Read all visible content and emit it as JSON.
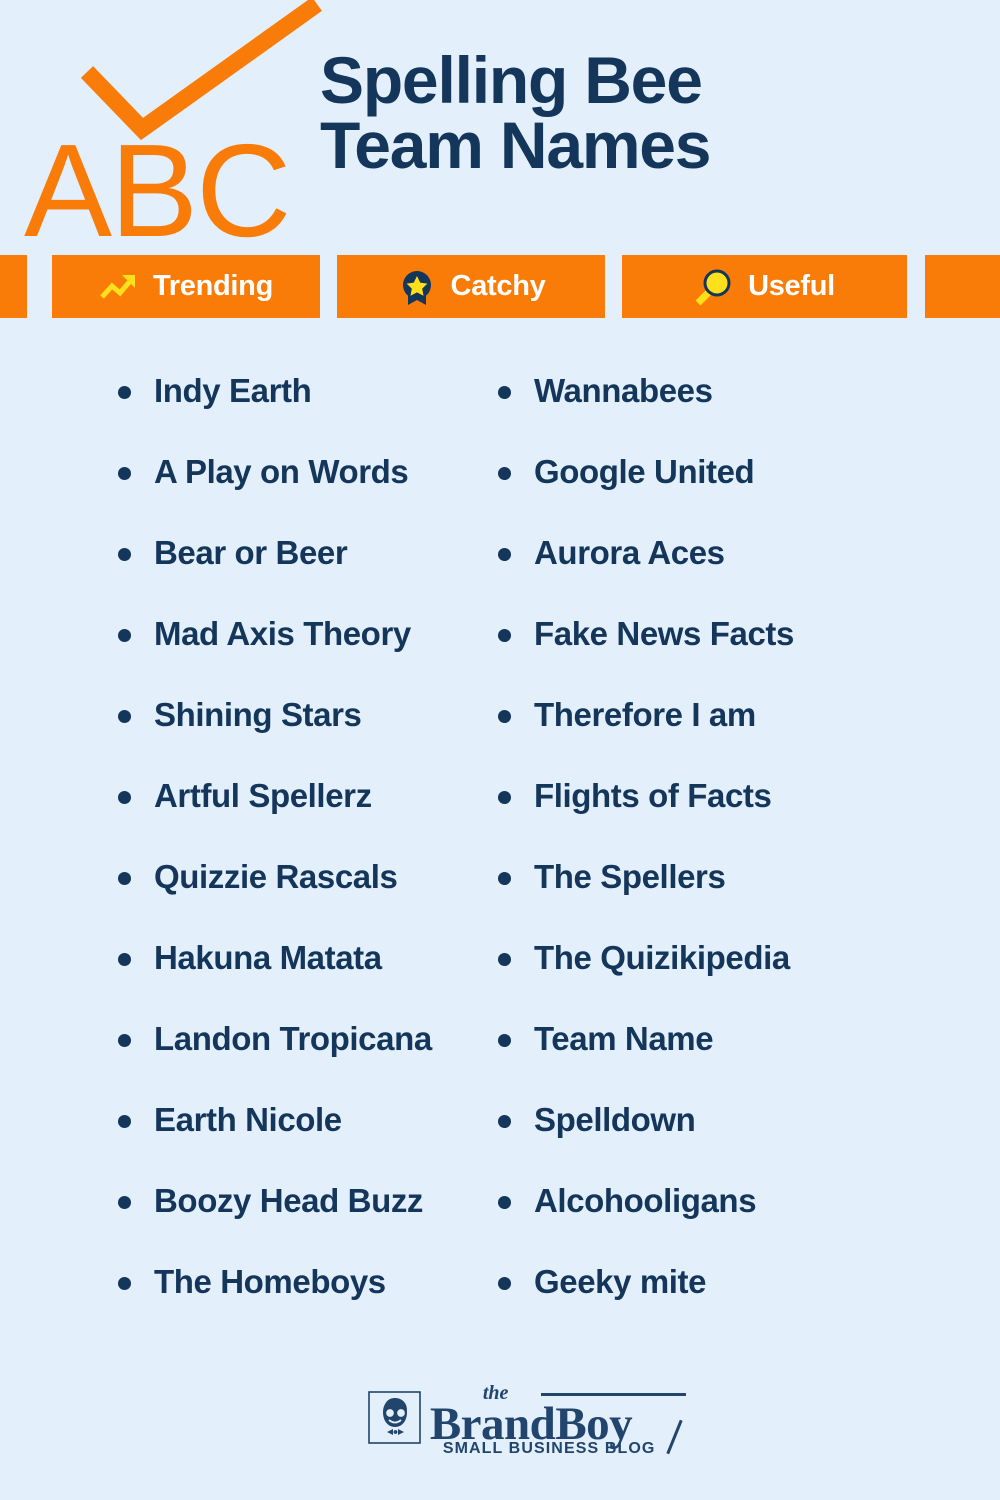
{
  "colors": {
    "background": "#e3effb",
    "accent_orange": "#f97c08",
    "navy": "#14365a",
    "yellow": "#ffe01b",
    "white": "#ffffff",
    "logo_navy": "#21456c"
  },
  "header": {
    "decor": {
      "abc_text": "ABC",
      "check_icon": "checkmark-icon"
    },
    "title_line1": "Spelling Bee",
    "title_line2": "Team Names"
  },
  "badges": [
    {
      "label": "Trending",
      "icon": "trending-up-icon"
    },
    {
      "label": "Catchy",
      "icon": "award-star-icon"
    },
    {
      "label": "Useful",
      "icon": "magnifier-icon"
    }
  ],
  "lists": {
    "left": [
      "Indy Earth",
      "A Play on Words",
      "Bear or Beer",
      "Mad Axis Theory",
      "Shining Stars",
      "Artful Spellerz",
      "Quizzie Rascals",
      "Hakuna Matata",
      "Landon Tropicana",
      "Earth Nicole",
      "Boozy Head Buzz",
      "The Homeboys"
    ],
    "right": [
      "Wannabees",
      "Google United",
      "Aurora Aces",
      "Fake News Facts",
      "Therefore I am",
      "Flights of Facts",
      "The Spellers",
      "The Quizikipedia",
      "Team Name",
      "Spelldown",
      "Alcohooligans",
      "Geeky mite"
    ]
  },
  "footer": {
    "logo_mark": "brandboy-avatar-icon",
    "the": "the",
    "brandboy": "BrandBoy",
    "tagline": "SMALL BUSINESS BLOG"
  }
}
